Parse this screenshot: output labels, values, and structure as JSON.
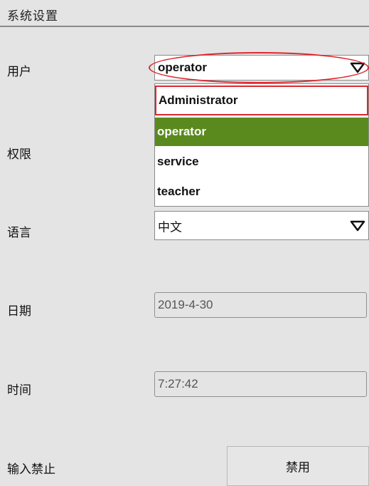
{
  "header": {
    "title": "系统设置"
  },
  "labels": {
    "user": "用户",
    "permission": "权限",
    "language": "语言",
    "date": "日期",
    "time": "时间",
    "input_lock": "输入禁止"
  },
  "user_select": {
    "value": "operator",
    "options": [
      "Administrator",
      "operator",
      "service",
      "teacher"
    ],
    "selected_index": 1
  },
  "language_select": {
    "value": "中文"
  },
  "date_field": {
    "value": "2019-4-30"
  },
  "time_field": {
    "value": "7:27:42"
  },
  "input_lock_button": {
    "label": "禁用"
  },
  "colors": {
    "background": "#e4e4e4",
    "selected_option": "#5a8a1d",
    "annotation_red": "#e0262e"
  },
  "icons": {
    "dropdown": "triangle-down-icon"
  }
}
